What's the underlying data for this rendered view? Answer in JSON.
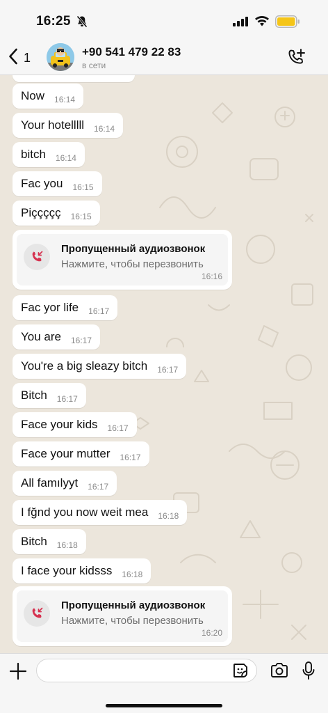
{
  "status_bar": {
    "time": "16:25"
  },
  "header": {
    "back_count": "1",
    "contact_name": "+90 541 479 22 83",
    "contact_status": "в сети"
  },
  "messages": [
    {
      "text": "Now",
      "time": "16:14"
    },
    {
      "text": "Your hotelllll",
      "time": "16:14"
    },
    {
      "text": "bitch",
      "time": "16:14"
    },
    {
      "text": "Fac you",
      "time": "16:15"
    },
    {
      "text": "Piççççç",
      "time": "16:15"
    },
    {
      "text": "Fac yor life",
      "time": "16:17"
    },
    {
      "text": "You are",
      "time": "16:17"
    },
    {
      "text": "You're a big sleazy bitch",
      "time": "16:17"
    },
    {
      "text": "Bitch",
      "time": "16:17"
    },
    {
      "text": "Face your kids",
      "time": "16:17"
    },
    {
      "text": "Face your mutter",
      "time": "16:17"
    },
    {
      "text": "All famılyyt",
      "time": "16:17"
    },
    {
      "text": "I fğnd you now weit mea",
      "time": "16:18"
    },
    {
      "text": "Bitch",
      "time": "16:18"
    },
    {
      "text": "I face your kidsss",
      "time": "16:18"
    }
  ],
  "missed_calls": [
    {
      "title": "Пропущенный аудиозвонок",
      "subtitle": "Нажмите, чтобы перезвонить",
      "time": "16:16"
    },
    {
      "title": "Пропущенный аудиозвонок",
      "subtitle": "Нажмите, чтобы перезвонить",
      "time": "16:20"
    }
  ],
  "input": {
    "placeholder": "",
    "value": ""
  },
  "colors": {
    "accent_red": "#d6314f",
    "bubble": "#ffffff",
    "chat_bg": "#ece6dc",
    "battery": "#f5c518"
  },
  "icons": [
    "bell-off-icon",
    "signal-icon",
    "wifi-icon",
    "battery-icon",
    "back-chevron-icon",
    "add-call-icon",
    "missed-call-icon",
    "plus-icon",
    "sticker-icon",
    "camera-icon",
    "mic-icon"
  ]
}
